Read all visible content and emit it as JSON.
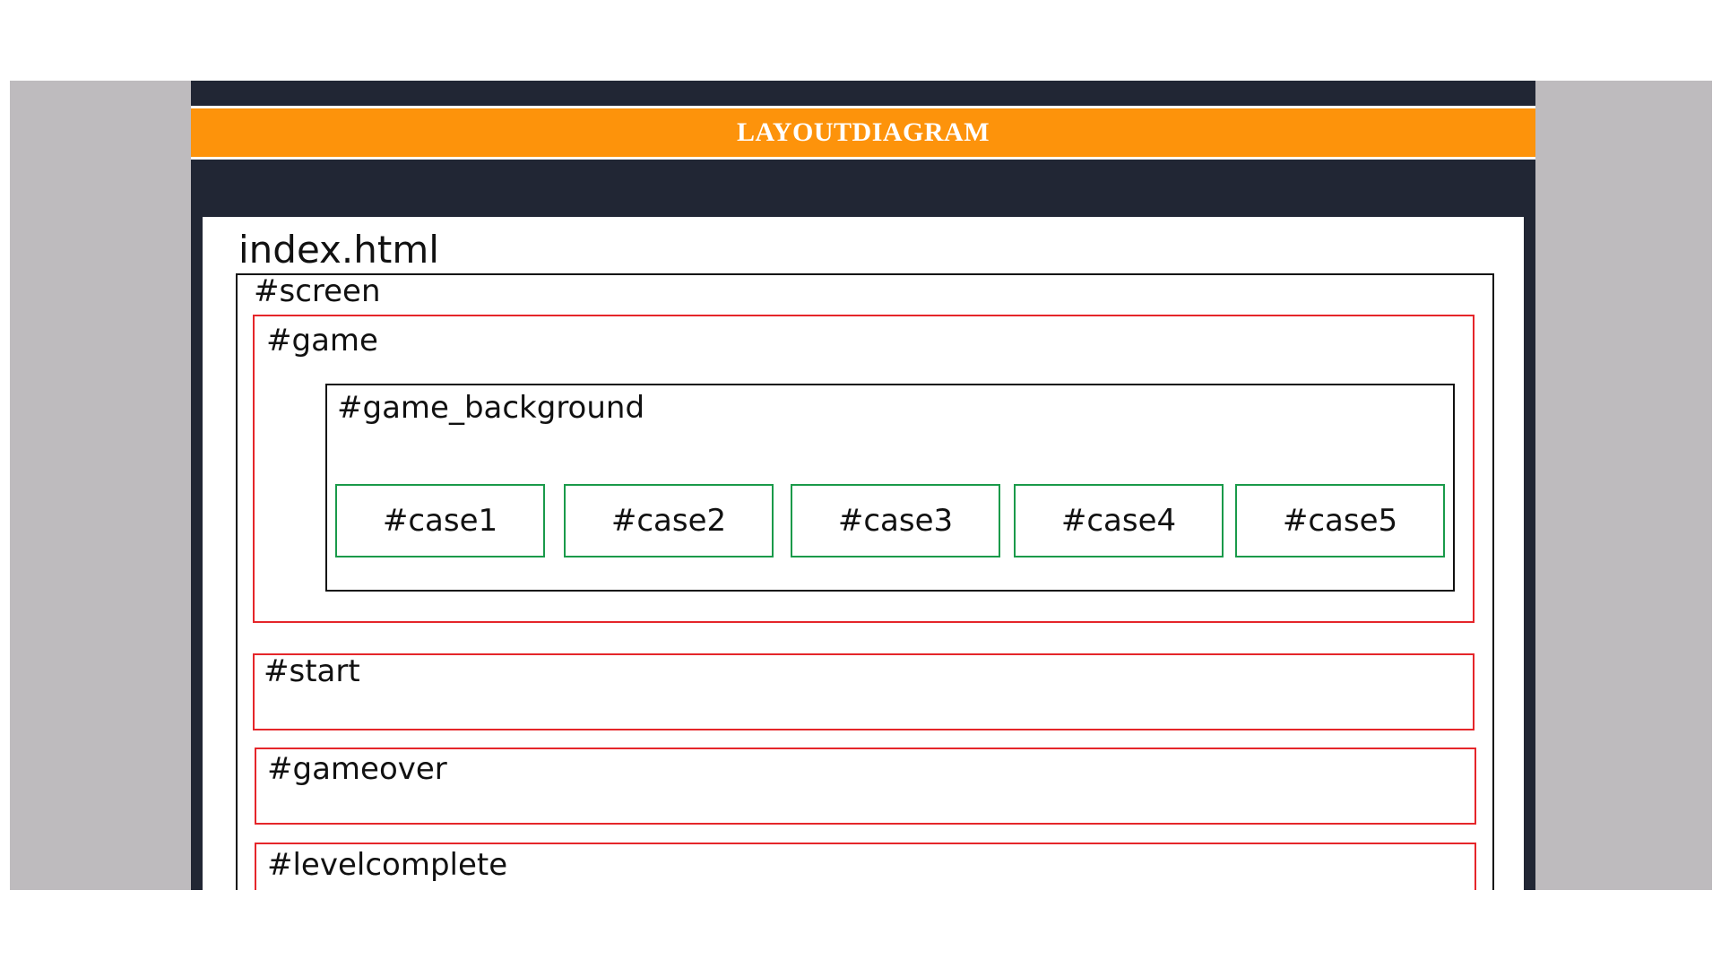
{
  "banner": {
    "title": "LAYOUTDIAGRAM"
  },
  "diagram": {
    "page_title": "index.html",
    "screen": "#screen",
    "game": "#game",
    "game_background": "#game_background",
    "cases": [
      "#case1",
      "#case2",
      "#case3",
      "#case4",
      "#case5"
    ],
    "start": "#start",
    "gameover": "#gameover",
    "levelcomplete": "#levelcomplete"
  },
  "colors": {
    "banner": "#fd930b",
    "frame": "#212634",
    "viewport": "#bebbbe",
    "red_border": "#e5262a",
    "green_border": "#1a9a4a"
  }
}
